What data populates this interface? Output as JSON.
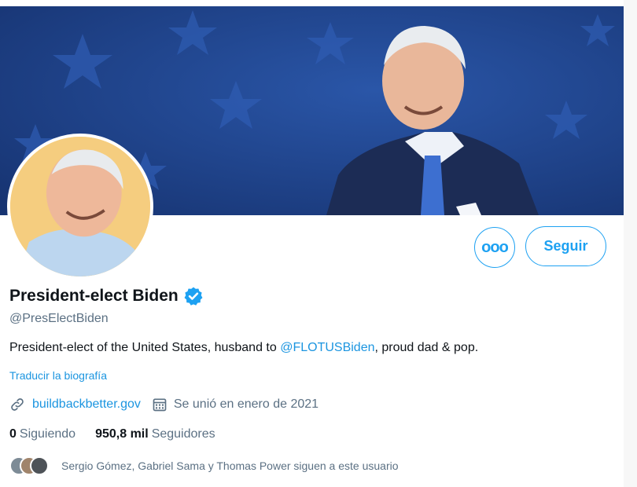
{
  "profile": {
    "name": "President-elect Biden",
    "handle": "@PresElectBiden",
    "bio_prefix": "President-elect of the United States, husband to ",
    "bio_mention": "@FLOTUSBiden",
    "bio_suffix": ", proud dad & pop.",
    "translate_label": "Traducir la biografía",
    "website": "buildbackbetter.gov",
    "joined": "Se unió en enero de 2021",
    "following_count": "0",
    "following_label": "Siguiendo",
    "followers_count": "950,8 mil",
    "followers_label": "Seguidores",
    "known_followers": "Sergio Gómez, Gabriel Sama y Thomas Power siguen a este usuario"
  },
  "actions": {
    "follow_label": "Seguir",
    "more_label": "ooo"
  },
  "icons": {
    "verified": "verified-badge-icon",
    "link": "link-icon",
    "calendar": "calendar-icon",
    "more": "more-options-icon"
  },
  "colors": {
    "accent": "#1da1f2",
    "link": "#1b95e0",
    "secondary_text": "#5b7083",
    "banner_blue": "#1e3f87"
  }
}
